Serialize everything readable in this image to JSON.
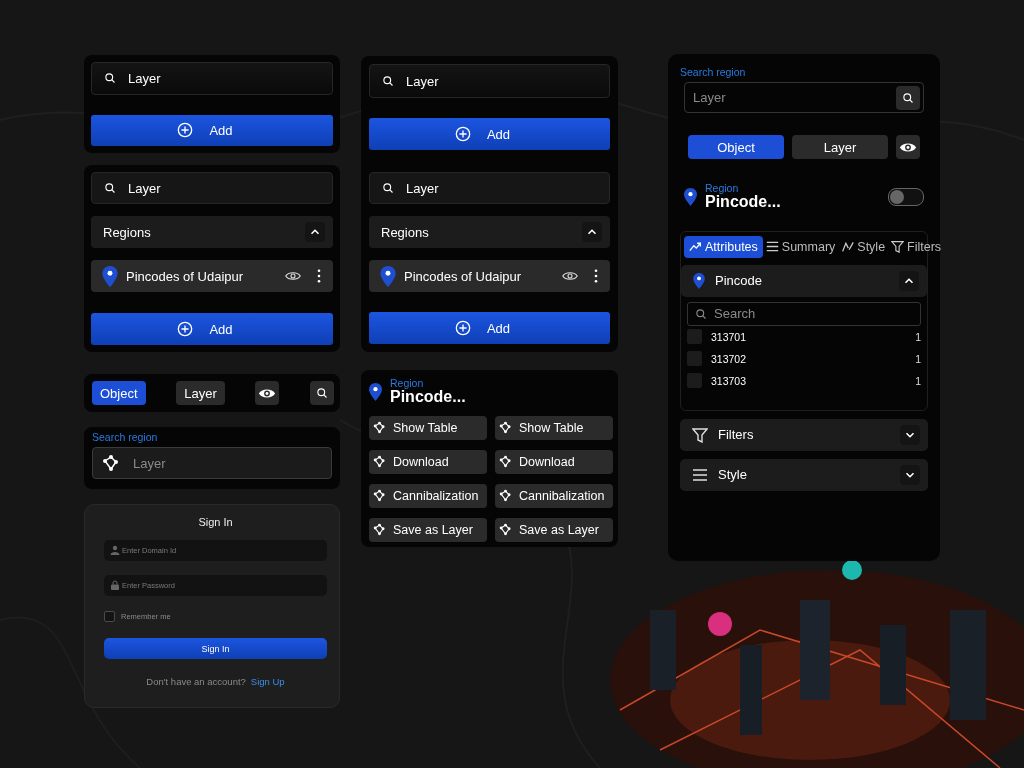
{
  "column_1": {
    "add_card": {
      "search_value": "Layer",
      "add_button": "Add"
    },
    "layer_card": {
      "search_value": "Layer",
      "section": {
        "title": "Regions",
        "expanded": true
      },
      "layer_item": "Pincodes of Udaipur",
      "add_button": "Add"
    },
    "view_toggle": [
      {
        "label": "Object",
        "selected": true
      },
      {
        "label": "Layer",
        "selected": false
      }
    ],
    "search_region": {
      "label": "Search region",
      "placeholder": "Layer"
    },
    "sign_in": {
      "title": "Sign In",
      "fields": [
        {
          "placeholder": "Enter Domain Id",
          "kind": "user"
        },
        {
          "placeholder": "Enter Password",
          "kind": "password"
        }
      ],
      "remember": {
        "label": "Remember me",
        "checked": false
      },
      "button": "Sign In",
      "prompt": "Don't have an account?",
      "link": "Sign Up"
    }
  },
  "column_2": {
    "layer_card": {
      "top_search_value": "Layer",
      "top_add_button": "Add",
      "search_value": "Layer",
      "section": {
        "title": "Regions",
        "expanded": true
      },
      "layer_item": "Pincodes of Udaipur",
      "add_button": "Add"
    },
    "region_card": {
      "label": "Region",
      "title": "Pincode...",
      "actions": [
        {
          "label": "Show Table"
        },
        {
          "label": "Show Table"
        },
        {
          "label": "Download"
        },
        {
          "label": "Download"
        },
        {
          "label": "Cannibalization"
        },
        {
          "label": "Cannibalization"
        },
        {
          "label": "Save as Layer"
        },
        {
          "label": "Save as Layer"
        }
      ]
    }
  },
  "side_panel": {
    "search": {
      "label": "Search region",
      "placeholder": "Layer"
    },
    "view_toggle": [
      {
        "label": "Object",
        "selected": true
      },
      {
        "label": "Layer",
        "selected": false
      }
    ],
    "region": {
      "label": "Region",
      "title": "Pincode...",
      "on": false
    },
    "tabs": [
      {
        "label": "Attributes",
        "kind": "trend",
        "selected": true
      },
      {
        "label": "Summary",
        "kind": "list",
        "selected": false
      },
      {
        "label": "Style",
        "kind": "brush",
        "selected": false
      },
      {
        "label": "Filters",
        "kind": "filter",
        "selected": false
      }
    ],
    "sections": [
      {
        "title": "Pincode",
        "kind": "pin",
        "expanded": true,
        "search_placeholder": "Search",
        "rows": [
          {
            "code": "313701",
            "count": "1",
            "checked": false
          },
          {
            "code": "313702",
            "count": "1",
            "checked": false
          },
          {
            "code": "313703",
            "count": "1",
            "checked": false
          }
        ]
      },
      {
        "title": "Filters",
        "kind": "filter",
        "expanded": false
      },
      {
        "title": "Style",
        "kind": "list",
        "expanded": false
      }
    ]
  }
}
